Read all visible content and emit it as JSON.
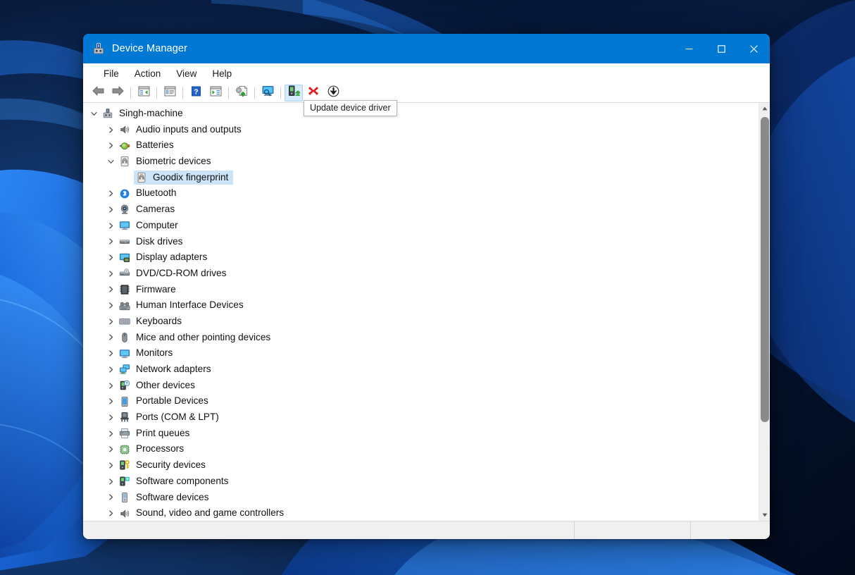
{
  "window": {
    "title": "Device Manager",
    "icon": "device-manager-icon",
    "controls": {
      "minimize": "—",
      "maximize": "□",
      "close": "✕"
    }
  },
  "menubar": {
    "items": [
      {
        "label": "File",
        "name": "menu-file"
      },
      {
        "label": "Action",
        "name": "menu-action"
      },
      {
        "label": "View",
        "name": "menu-view"
      },
      {
        "label": "Help",
        "name": "menu-help"
      }
    ]
  },
  "toolbar": {
    "buttons": [
      {
        "icon": "back-arrow-icon",
        "name": "toolbar-back",
        "tip": "Back"
      },
      {
        "icon": "forward-arrow-icon",
        "name": "toolbar-forward",
        "tip": "Forward"
      },
      {
        "icon": "show-hide-console-tree-icon",
        "name": "toolbar-show-hide-console-tree",
        "tip": "Show/Hide Console Tree"
      },
      {
        "icon": "properties-icon",
        "name": "toolbar-properties",
        "tip": "Properties"
      },
      {
        "icon": "help-icon",
        "name": "toolbar-help",
        "tip": "Help"
      },
      {
        "icon": "show-hide-action-pane-icon",
        "name": "toolbar-show-hide-action-pane",
        "tip": "Show/Hide Action Pane"
      },
      {
        "icon": "scan-hardware-changes-icon",
        "name": "toolbar-scan-for-hardware-changes",
        "tip": "Scan for hardware changes"
      },
      {
        "icon": "update-driver-monitor-icon",
        "name": "toolbar-update-driver-monitor",
        "tip": "Update driver"
      },
      {
        "icon": "update-device-driver-icon",
        "name": "toolbar-update-device-driver",
        "tip": "Update device driver"
      },
      {
        "icon": "uninstall-device-icon",
        "name": "toolbar-uninstall-device",
        "tip": "Uninstall device"
      },
      {
        "icon": "disable-device-icon",
        "name": "toolbar-disable-device",
        "tip": "Disable device"
      }
    ],
    "tooltip": "Update device driver",
    "active_button_index": 8
  },
  "tree": {
    "root": {
      "label": "Singh-machine",
      "icon": "computer-root-icon",
      "expanded": true
    },
    "nodes": [
      {
        "label": "Audio inputs and outputs",
        "icon": "speaker-icon",
        "expanded": false,
        "depth": 1,
        "selected": false
      },
      {
        "label": "Batteries",
        "icon": "battery-icon",
        "expanded": false,
        "depth": 1,
        "selected": false
      },
      {
        "label": "Biometric devices",
        "icon": "fingerprint-icon",
        "expanded": true,
        "depth": 1,
        "selected": false
      },
      {
        "label": "Goodix fingerprint",
        "icon": "fingerprint-icon",
        "expanded": null,
        "depth": 2,
        "selected": true
      },
      {
        "label": "Bluetooth",
        "icon": "bluetooth-icon",
        "expanded": false,
        "depth": 1,
        "selected": false
      },
      {
        "label": "Cameras",
        "icon": "camera-icon",
        "expanded": false,
        "depth": 1,
        "selected": false
      },
      {
        "label": "Computer",
        "icon": "monitor-icon",
        "expanded": false,
        "depth": 1,
        "selected": false
      },
      {
        "label": "Disk drives",
        "icon": "disk-drive-icon",
        "expanded": false,
        "depth": 1,
        "selected": false
      },
      {
        "label": "Display adapters",
        "icon": "display-adapter-icon",
        "expanded": false,
        "depth": 1,
        "selected": false
      },
      {
        "label": "DVD/CD-ROM drives",
        "icon": "optical-drive-icon",
        "expanded": false,
        "depth": 1,
        "selected": false
      },
      {
        "label": "Firmware",
        "icon": "firmware-chip-icon",
        "expanded": false,
        "depth": 1,
        "selected": false
      },
      {
        "label": "Human Interface Devices",
        "icon": "hid-icon",
        "expanded": false,
        "depth": 1,
        "selected": false
      },
      {
        "label": "Keyboards",
        "icon": "keyboard-icon",
        "expanded": false,
        "depth": 1,
        "selected": false
      },
      {
        "label": "Mice and other pointing devices",
        "icon": "mouse-icon",
        "expanded": false,
        "depth": 1,
        "selected": false
      },
      {
        "label": "Monitors",
        "icon": "monitor-icon",
        "expanded": false,
        "depth": 1,
        "selected": false
      },
      {
        "label": "Network adapters",
        "icon": "network-adapter-icon",
        "expanded": false,
        "depth": 1,
        "selected": false
      },
      {
        "label": "Other devices",
        "icon": "other-device-question-icon",
        "expanded": false,
        "depth": 1,
        "selected": false
      },
      {
        "label": "Portable Devices",
        "icon": "portable-device-icon",
        "expanded": false,
        "depth": 1,
        "selected": false
      },
      {
        "label": "Ports (COM & LPT)",
        "icon": "port-icon",
        "expanded": false,
        "depth": 1,
        "selected": false
      },
      {
        "label": "Print queues",
        "icon": "printer-icon",
        "expanded": false,
        "depth": 1,
        "selected": false
      },
      {
        "label": "Processors",
        "icon": "processor-icon",
        "expanded": false,
        "depth": 1,
        "selected": false
      },
      {
        "label": "Security devices",
        "icon": "security-key-icon",
        "expanded": false,
        "depth": 1,
        "selected": false
      },
      {
        "label": "Software components",
        "icon": "software-component-icon",
        "expanded": false,
        "depth": 1,
        "selected": false
      },
      {
        "label": "Software devices",
        "icon": "software-device-icon",
        "expanded": false,
        "depth": 1,
        "selected": false
      },
      {
        "label": "Sound, video and game controllers",
        "icon": "sound-controller-icon",
        "expanded": false,
        "depth": 1,
        "selected": false
      }
    ],
    "twisty_collapsed": "›",
    "twisty_expanded": "∨"
  },
  "statusbar": {
    "pane_main": "",
    "pane_two": "",
    "pane_three": ""
  },
  "colors": {
    "titlebar": "#0078d4",
    "selection": "#cce4f7",
    "toolbar_active": "#d6ebfb",
    "desktop_deep": "#07142e",
    "desktop_blue": "#1565d8"
  }
}
